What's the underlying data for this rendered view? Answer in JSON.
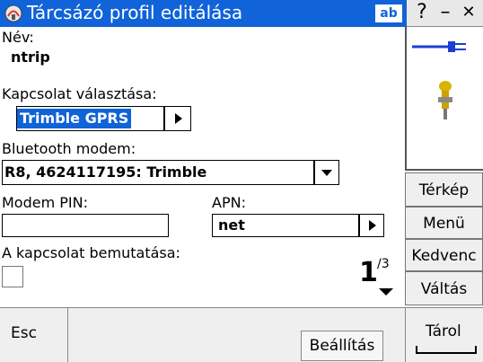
{
  "window": {
    "title": "Tárcsázó profil editálása",
    "input_mode_badge": "ab",
    "help_label": "?",
    "minimize_label": "–",
    "close_label": "✕"
  },
  "form": {
    "name_label": "Név:",
    "name_value": "ntrip",
    "connection_label": "Kapcsolat választása:",
    "connection_value": "Trimble GPRS",
    "bluetooth_label": "Bluetooth modem:",
    "bluetooth_value": "R8, 4624117195: Trimble",
    "pin_label": "Modem PIN:",
    "pin_value": "",
    "apn_label": "APN:",
    "apn_value": "net",
    "show_connection_label": "A kapcsolat bemutatása:",
    "show_connection_checked": false,
    "page_current": "1",
    "page_total": "/3"
  },
  "side_panel": {
    "buttons": [
      "Térkép",
      "Menü",
      "Kedvenc",
      "Váltás"
    ]
  },
  "bottom": {
    "esc_label": "Esc",
    "settings_label": "Beállítás",
    "store_label": "Tárol"
  },
  "colors": {
    "titlebar": "#1063d8",
    "selection": "#1063d8",
    "connector": "#1a3fd0"
  }
}
